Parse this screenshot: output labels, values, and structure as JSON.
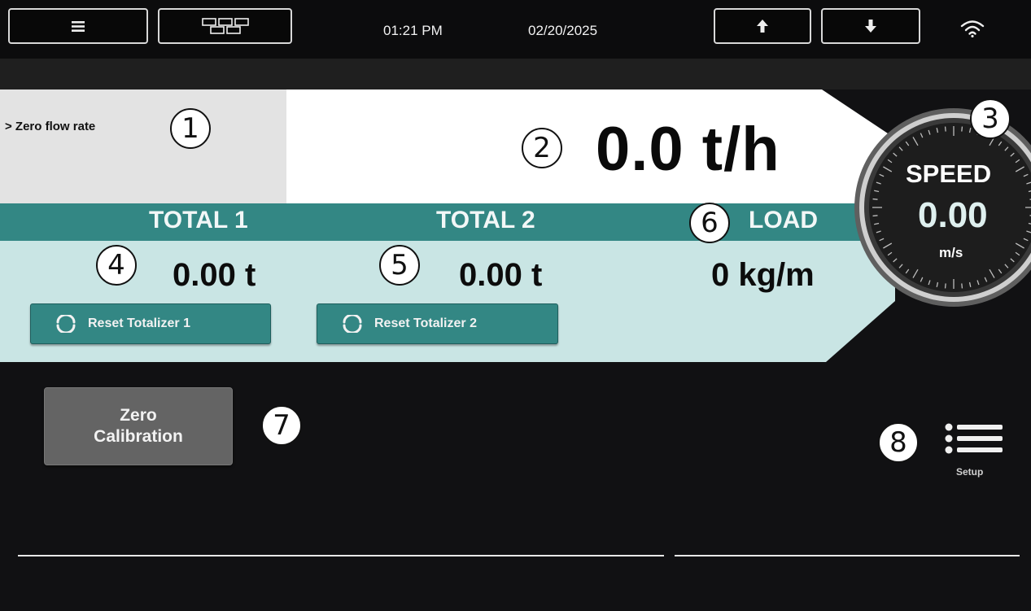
{
  "header": {
    "menu_icon": "hamburger-menu-icon",
    "layout_icon": "layout-grid-icon",
    "time": "01:21 PM",
    "date": "02/20/2025",
    "up_icon": "arrow-up-icon",
    "down_icon": "arrow-down-icon",
    "wifi_icon": "wifi-icon"
  },
  "status": {
    "message": "> Zero flow rate"
  },
  "flow": {
    "value": "0.0 t/h"
  },
  "speed": {
    "label": "SPEED",
    "value": "0.00",
    "unit": "m/s"
  },
  "totals": [
    {
      "header": "TOTAL 1",
      "value": "0.00 t",
      "reset_label": "Reset Totalizer 1"
    },
    {
      "header": "TOTAL 2",
      "value": "0.00 t",
      "reset_label": "Reset Totalizer 2"
    }
  ],
  "load": {
    "header": "LOAD",
    "value": "0 kg/m"
  },
  "zero_calibration": {
    "line1": "Zero",
    "line2": "Calibration"
  },
  "setup": {
    "label": "Setup",
    "icon": "list-icon"
  },
  "callouts": [
    "1",
    "2",
    "3",
    "4",
    "5",
    "6",
    "7",
    "8"
  ],
  "colors": {
    "teal": "#338784",
    "light_teal": "#c9e5e4",
    "background": "#111113"
  }
}
